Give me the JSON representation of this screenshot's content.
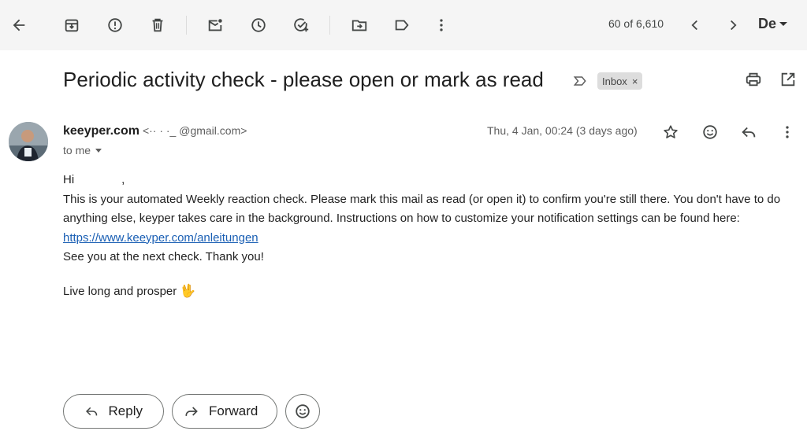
{
  "toolbar": {
    "back_icon": "arrow-left-icon",
    "buttons": [
      {
        "name": "archive-icon"
      },
      {
        "name": "report-spam-icon"
      },
      {
        "name": "delete-icon"
      },
      {
        "name": "mark-unread-icon"
      },
      {
        "name": "snooze-icon"
      },
      {
        "name": "add-to-tasks-icon"
      },
      {
        "name": "move-to-icon"
      },
      {
        "name": "labels-icon"
      },
      {
        "name": "more-vert-icon"
      }
    ],
    "counter": "60 of 6,610",
    "language": "De"
  },
  "email": {
    "subject": "Periodic activity check - please open or mark as read",
    "label": "Inbox",
    "label_remove": "×",
    "sender_name": "keeyper.com",
    "sender_email": "<·· · ·_ @gmail.com>",
    "recipient": "to me",
    "date": "Thu, 4 Jan, 00:24 (3 days ago)",
    "greeting_prefix": "Hi",
    "greeting_suffix": ",",
    "paragraph": "This is your automated Weekly reaction check. Please mark this mail as read (or open it) to confirm you're still there. You don't have to do anything else, keyper takes care in the background. Instructions on how to customize your notification settings can be found here:",
    "link": "https://www.keeyper.com/anleitungen",
    "closing_line": "See you at the next check. Thank you!",
    "signoff": "Live long and prosper",
    "signoff_emoji": "🖖"
  },
  "actions": {
    "reply_label": "Reply",
    "forward_label": "Forward"
  },
  "colors": {
    "toolbar_bg": "#f5f5f5",
    "link": "#1a5fb4",
    "label_chip_bg": "#dddddd",
    "emoji": "#f2b01e"
  }
}
